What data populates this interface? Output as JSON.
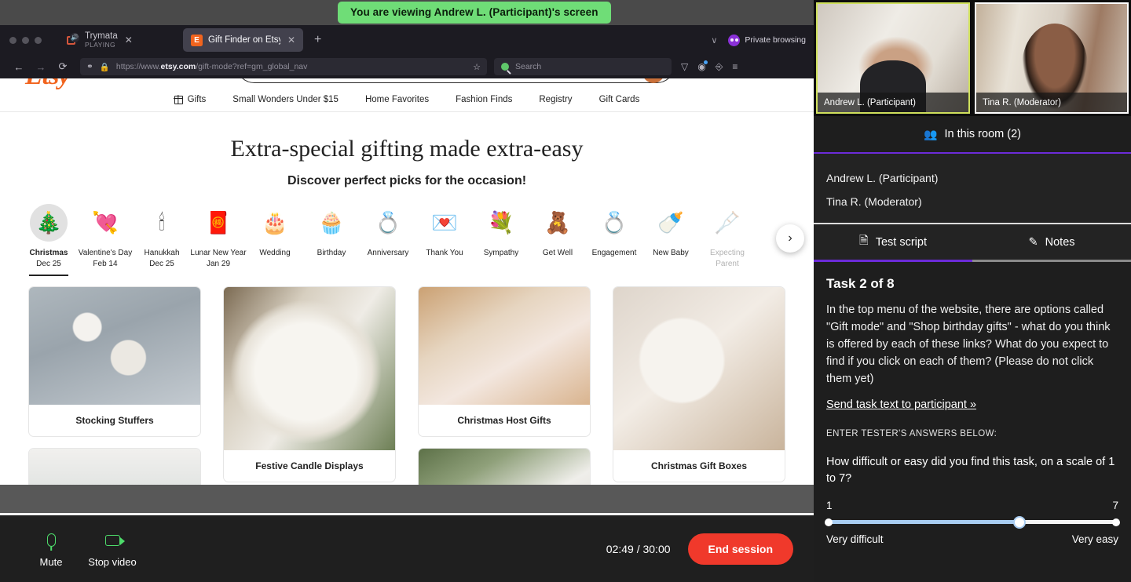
{
  "banner": {
    "text": "You are viewing Andrew L. (Participant)'s screen"
  },
  "browser": {
    "tabs": [
      {
        "title": "Trymata",
        "subtitle": "PLAYING",
        "favicon": "trymata-icon",
        "active": false,
        "close": "✕"
      },
      {
        "title": "Gift Finder on Etsy - Get Perfec",
        "favicon": "etsy-icon",
        "letter": "E",
        "active": true,
        "close": "✕"
      }
    ],
    "new_tab_label": "+",
    "tab_list_chevron": "∨",
    "private_browsing_label": "Private browsing",
    "back_label": "←",
    "forward_label": "→",
    "reload_label": "⟳",
    "url_protocol": "https://www.",
    "url_domain": "etsy.com",
    "url_path": "/gift-mode?ref=gm_global_nav",
    "shield_icon": "⬢",
    "lock_icon": "🔒",
    "bookmark_icon": "☆",
    "search_placeholder": "Search",
    "toolbar_icons": [
      "save-to-pocket-icon",
      "account-icon",
      "share-icon",
      "list-all-tabs-icon"
    ]
  },
  "etsy": {
    "logo": "Etsy",
    "nav": [
      {
        "label": "Gifts",
        "icon": "gift-icon"
      },
      {
        "label": "Small Wonders Under $15",
        "icon": ""
      },
      {
        "label": "Home Favorites",
        "icon": ""
      },
      {
        "label": "Fashion Finds",
        "icon": ""
      },
      {
        "label": "Registry",
        "icon": ""
      },
      {
        "label": "Gift Cards",
        "icon": ""
      }
    ],
    "hero_title": "Extra-special gifting made extra-easy",
    "hero_subtitle": "Discover perfect picks for the occasion!",
    "carousel_next": "›",
    "occasions": [
      {
        "label": "Christmas",
        "date": "Dec 25",
        "glyph": "🎄",
        "active": true,
        "faded": false
      },
      {
        "label": "Valentine's Day",
        "date": "Feb 14",
        "glyph": "💘",
        "active": false,
        "faded": false
      },
      {
        "label": "Hanukkah",
        "date": "Dec 25",
        "glyph": "🕯",
        "active": false,
        "faded": false
      },
      {
        "label": "Lunar New Year",
        "date": "Jan 29",
        "glyph": "🧧",
        "active": false,
        "faded": false
      },
      {
        "label": "Wedding",
        "date": "",
        "glyph": "🎂",
        "active": false,
        "faded": false
      },
      {
        "label": "Birthday",
        "date": "",
        "glyph": "🧁",
        "active": false,
        "faded": false
      },
      {
        "label": "Anniversary",
        "date": "",
        "glyph": "💍",
        "active": false,
        "faded": false
      },
      {
        "label": "Thank You",
        "date": "",
        "glyph": "💌",
        "active": false,
        "faded": false
      },
      {
        "label": "Sympathy",
        "date": "",
        "glyph": "💐",
        "active": false,
        "faded": false
      },
      {
        "label": "Get Well",
        "date": "",
        "glyph": "🧸",
        "active": false,
        "faded": false
      },
      {
        "label": "Engagement",
        "date": "",
        "glyph": "💍",
        "active": false,
        "faded": false
      },
      {
        "label": "New Baby",
        "date": "",
        "glyph": "🍼",
        "active": false,
        "faded": false
      },
      {
        "label": "Expecting Parent",
        "date": "",
        "glyph": "🩼",
        "active": false,
        "faded": true
      }
    ],
    "cards": {
      "col1": [
        {
          "caption": "Stocking Stuffers",
          "photo": "ph-stockings"
        },
        {
          "caption": "",
          "photo": "ph-bottle"
        }
      ],
      "col2": [
        {
          "caption": "Festive Candle Displays",
          "photo": "ph-candle"
        }
      ],
      "col3": [
        {
          "caption": "Christmas Host Gifts",
          "photo": "ph-host"
        },
        {
          "caption": "",
          "photo": "ph-orn"
        }
      ],
      "col4": [
        {
          "caption": "Christmas Gift Boxes",
          "photo": "ph-boxes"
        }
      ]
    }
  },
  "controls": {
    "mute_label": "Mute",
    "video_label": "Stop video",
    "timer": "02:49 / 30:00",
    "end_session_label": "End session"
  },
  "side": {
    "videos": [
      {
        "name": "Andrew L. (Participant)",
        "speaking": true
      },
      {
        "name": "Tina R. (Moderator)",
        "speaking": false
      }
    ],
    "room_header": "In this room (2)",
    "roster": [
      "Andrew L. (Participant)",
      "Tina R. (Moderator)"
    ],
    "tabs": [
      {
        "label": "Test script",
        "icon": "script-icon",
        "active": true
      },
      {
        "label": "Notes",
        "icon": "pencil-icon",
        "active": false
      }
    ],
    "task_title": "Task 2 of 8",
    "task_body": "In the top menu of the website, there are options called \"Gift mode\" and \"Shop birthday gifts\" - what do you think is offered by each of these links? What do you expect to find if you click on each of them? (Please do not click them yet)",
    "send_link": "Send task text to participant »",
    "answers_label": "ENTER TESTER'S ANSWERS BELOW:",
    "question": "How difficult or easy did you find this task, on a scale of 1 to 7?",
    "scale_min": "1",
    "scale_max": "7",
    "scale_min_label": "Very difficult",
    "scale_max_label": "Very easy",
    "slider_percent": 66
  },
  "colors": {
    "banner_green": "#6fdd77",
    "accent_purple": "#6c2bd9",
    "end_red": "#f0392b",
    "active_speaker": "#cfe05c",
    "slider_fill": "#a9cdf2",
    "mic_green": "#4ddb6a",
    "etsy_orange": "#f1641e"
  }
}
